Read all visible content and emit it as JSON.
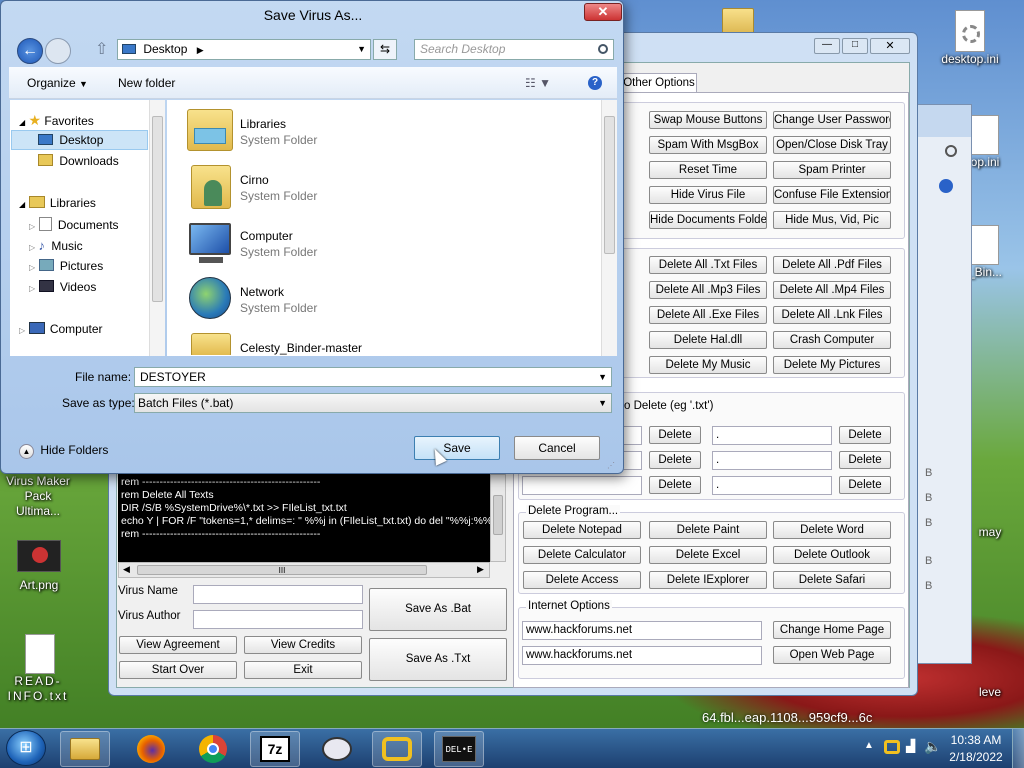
{
  "dialog": {
    "title": "Save Virus As...",
    "close_label": "✕",
    "location": "Desktop",
    "search_placeholder": "Search Desktop",
    "organize_label": "Organize",
    "new_folder_label": "New folder",
    "nav": {
      "favorites": "Favorites",
      "desktop": "Desktop",
      "downloads": "Downloads",
      "libraries": "Libraries",
      "documents": "Documents",
      "music": "Music",
      "pictures": "Pictures",
      "videos": "Videos",
      "computer": "Computer"
    },
    "files": [
      {
        "name": "Libraries",
        "type": "System Folder"
      },
      {
        "name": "Cirno",
        "type": "System Folder"
      },
      {
        "name": "Computer",
        "type": "System Folder"
      },
      {
        "name": "Network",
        "type": "System Folder"
      },
      {
        "name": "Celesty_Binder-master",
        "type": ""
      }
    ],
    "file_name_label": "File name:",
    "file_name_value": "DESTOYER",
    "save_type_label": "Save as type:",
    "save_type_value": "Batch Files (*.bat)",
    "hide_folders_label": "Hide Folders",
    "save_label": "Save",
    "cancel_label": "Cancel"
  },
  "virus_maker": {
    "tab_other_options": "Other Options",
    "misc_buttons": [
      [
        "Swap Mouse Buttons",
        "Change User Password"
      ],
      [
        "Spam With MsgBox",
        "Open/Close Disk Tray"
      ],
      [
        "Reset Time",
        "Spam Printer"
      ],
      [
        "Hide Virus File",
        "Confuse File Extensions"
      ],
      [
        "Hide Documents Folder",
        "Hide Mus, Vid, Pic"
      ]
    ],
    "delete_buttons": [
      [
        "Delete All .Txt Files",
        "Delete All .Pdf Files"
      ],
      [
        "Delete All .Mp3 Files",
        "Delete All .Mp4 Files"
      ],
      [
        "Delete All .Exe Files",
        "Delete All .Lnk Files"
      ],
      [
        "Delete Hal.dll",
        "Crash Computer"
      ],
      [
        "Delete My Music",
        "Delete My Pictures"
      ]
    ],
    "ext_label": "o Delete (eg '.txt')",
    "ext_rows": [
      {
        "mid": ".",
        "btn1": "Delete",
        "btn2": "Delete"
      },
      {
        "mid": ".",
        "btn1": "Delete",
        "btn2": "Delete"
      },
      {
        "mid": ".",
        "btn1": "Delete",
        "btn2": "Delete"
      }
    ],
    "delete_program_label": "Delete Program...",
    "program_buttons": [
      [
        "Delete Notepad",
        "Delete Paint",
        "Delete Word"
      ],
      [
        "Delete Calculator",
        "Delete Excel",
        "Delete Outlook"
      ],
      [
        "Delete Access",
        "Delete IExplorer",
        "Delete Safari"
      ]
    ],
    "internet_label": "Internet Options",
    "home_url": "www.hackforums.net",
    "open_url": "www.hackforums.net",
    "change_home_label": "Change Home Page",
    "open_page_label": "Open Web Page",
    "code_lines": [
      "rem ---------------------------------------------------",
      "rem Delete All Texts",
      "DIR /S/B %SystemDrive%\\*.txt >> FIleList_txt.txt",
      "echo Y | FOR /F \"tokens=1,* delims=: \" %%j in (FIleList_txt.txt) do del \"%%j:%%",
      "rem ---------------------------------------------------"
    ],
    "scroll_mark": "III",
    "virus_name_label": "Virus Name",
    "virus_author_label": "Virus Author",
    "view_agreement_label": "View Agreement",
    "view_credits_label": "View Credits",
    "start_over_label": "Start Over",
    "exit_label": "Exit",
    "save_bat_label": "Save As .Bat",
    "save_txt_label": "Save As .Txt"
  },
  "desktop": {
    "icons": {
      "virus_maker": "Virus Maker Pack Ultima...",
      "art": "Art.png",
      "readme": "READ-INFO.txt",
      "desktop_ini": "desktop.ini",
      "ini2": "op.ini",
      "bin": "_Bin...",
      "may": "may",
      "lever": "leve"
    },
    "bg_filename": "64.fbl...eap.1108...959cf9...6c"
  },
  "taskbar": {
    "time": "10:38 AM",
    "date": "2/18/2022",
    "delwe": "DEL•E"
  }
}
